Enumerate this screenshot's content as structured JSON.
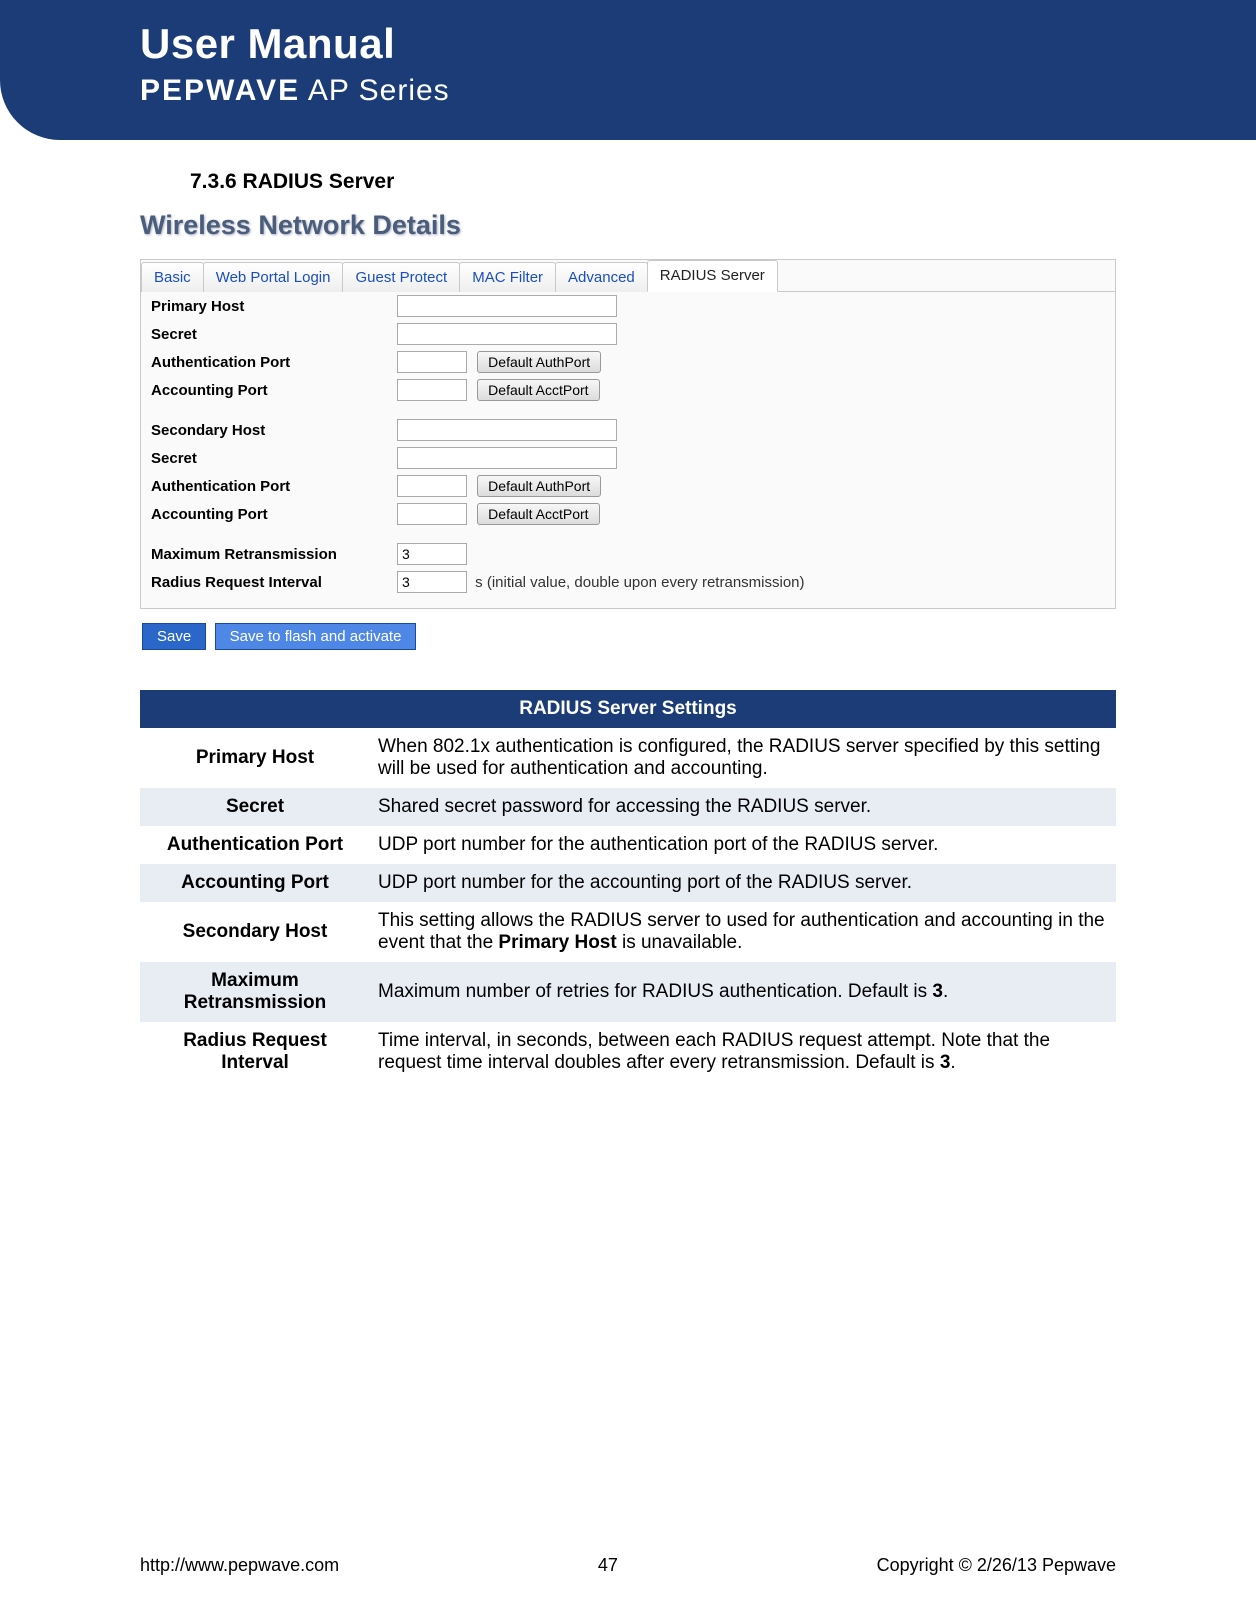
{
  "header": {
    "title": "User Manual",
    "brand_bold": "PEPWAVE",
    "brand_light": " AP Series"
  },
  "section": {
    "number_title": "7.3.6 RADIUS Server",
    "panel_title": "Wireless Network Details"
  },
  "tabs": {
    "basic": "Basic",
    "web_portal": "Web Portal Login",
    "guest_protect": "Guest Protect",
    "mac_filter": "MAC Filter",
    "advanced": "Advanced",
    "radius_server": "RADIUS Server"
  },
  "form": {
    "primary_host": "Primary Host",
    "secret": "Secret",
    "auth_port": "Authentication Port",
    "acct_port": "Accounting Port",
    "secondary_host": "Secondary Host",
    "max_retrans": "Maximum Retransmission",
    "req_interval": "Radius Request Interval",
    "btn_default_auth": "Default AuthPort",
    "btn_default_acct": "Default AcctPort",
    "val_max_retrans": "3",
    "val_req_interval": "3",
    "hint_interval": "s (initial value, double upon every retransmission)"
  },
  "buttons": {
    "save": "Save",
    "save_flash": "Save to flash and activate"
  },
  "settings": {
    "header": "RADIUS Server Settings",
    "rows": [
      {
        "name": "Primary Host",
        "desc": "When 802.1x authentication is configured, the RADIUS server specified by this setting will be used for authentication and accounting."
      },
      {
        "name": "Secret",
        "desc": "Shared secret password for accessing the RADIUS server."
      },
      {
        "name": "Authentication Port",
        "desc": "UDP port number for the authentication port of the RADIUS server."
      },
      {
        "name": "Accounting Port",
        "desc": "UDP port number for the accounting port of the RADIUS server."
      },
      {
        "name": "Secondary Host",
        "desc_pre": "This setting allows the RADIUS server to used for authentication and accounting in the event that the ",
        "desc_bold": "Primary Host",
        "desc_post": " is unavailable."
      },
      {
        "name": "Maximum Retransmission",
        "desc_pre": "Maximum number of retries for RADIUS authentication. Default is ",
        "desc_bold": "3",
        "desc_post": "."
      },
      {
        "name": "Radius Request Interval",
        "desc_pre": "Time interval, in seconds, between each RADIUS request attempt.  Note that the request time interval doubles after every retransmission. Default is ",
        "desc_bold": "3",
        "desc_post": "."
      }
    ]
  },
  "footer": {
    "url": "http://www.pepwave.com",
    "page": "47",
    "copyright": "Copyright © 2/26/13 Pepwave"
  }
}
